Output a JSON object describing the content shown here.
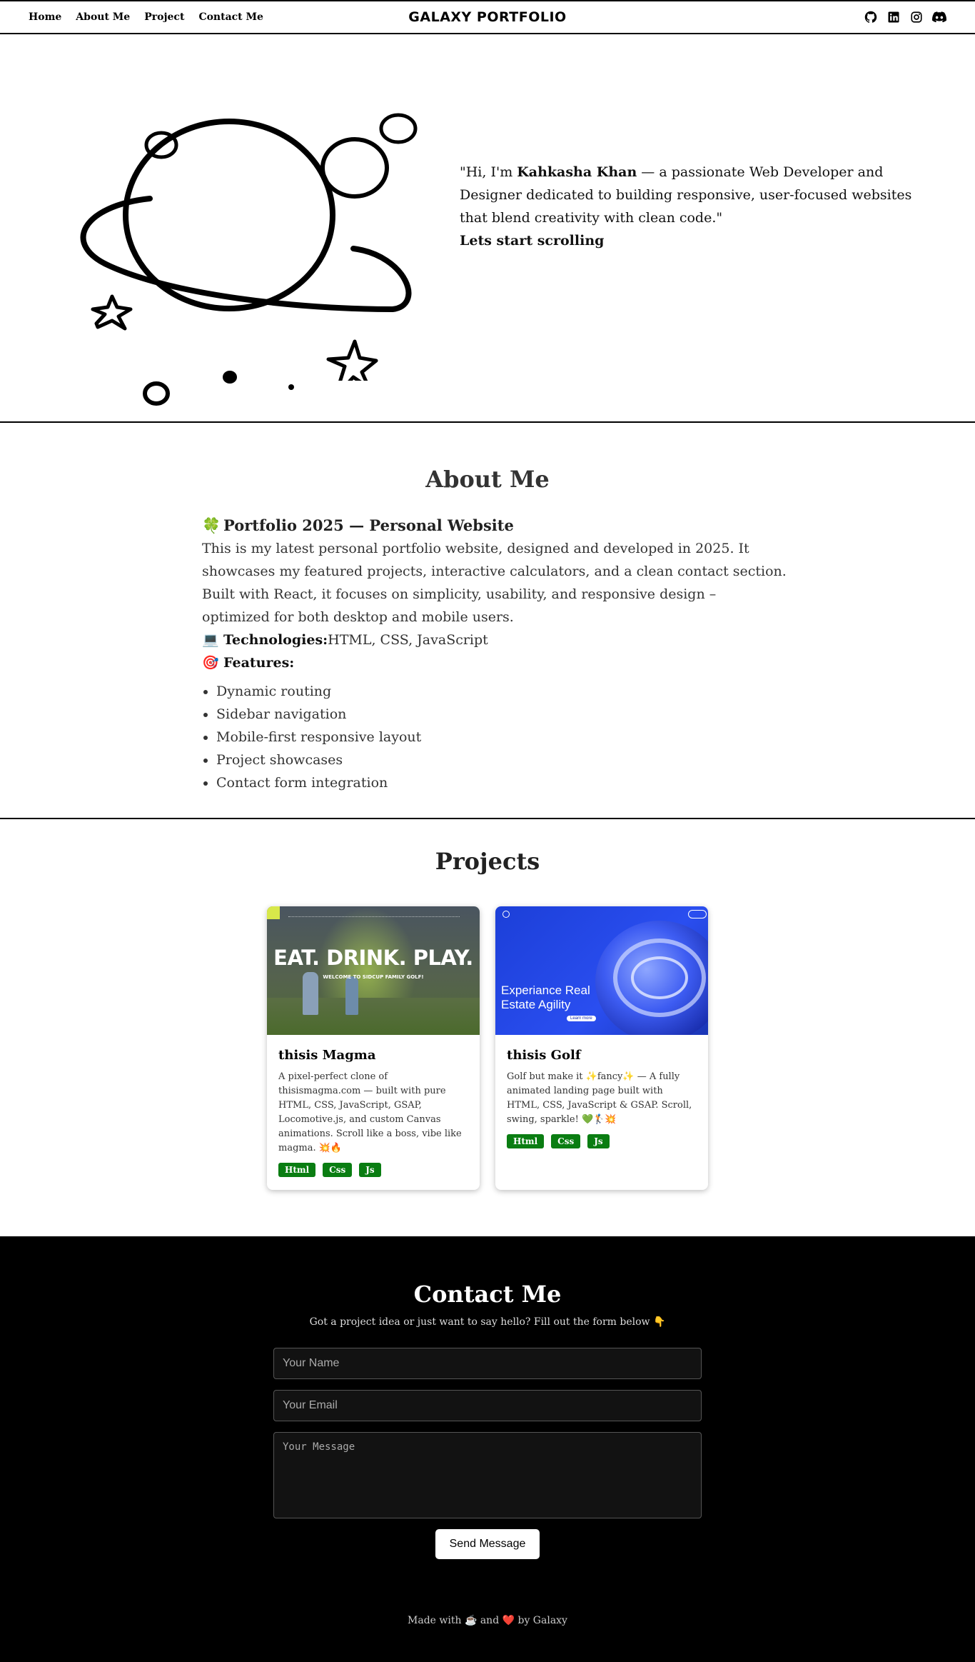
{
  "nav": {
    "links": [
      "Home",
      "About Me",
      "Project",
      "Contact Me"
    ],
    "brand": "GALAXY PORTFOLIO",
    "social": [
      "github-icon",
      "linkedin-icon",
      "instagram-icon",
      "discord-icon"
    ]
  },
  "hero": {
    "intro_pre": "\"Hi, I'm ",
    "name": "Kahkasha Khan",
    "intro_post": " — a passionate Web Developer and Designer dedicated to building responsive, user-focused websites that blend creativity with clean code.\"",
    "cta": "Lets start scrolling"
  },
  "about": {
    "title": "About Me",
    "heading_emoji": "🍀",
    "heading": "Portfolio 2025 — Personal Website",
    "description": "This is my latest personal portfolio website, designed and developed in 2025. It showcases my featured projects, interactive calculators, and a clean contact section. Built with React, it focuses on simplicity, usability, and responsive design – optimized for both desktop and mobile users.",
    "tech_emoji": "💻",
    "tech_label": "Technologies:",
    "tech_value": "HTML, CSS, JavaScript",
    "features_emoji": "🎯",
    "features_label": "Features:",
    "features": [
      "Dynamic routing",
      "Sidebar navigation",
      "Mobile-first responsive layout",
      "Project showcases",
      "Contact form integration"
    ]
  },
  "projects": {
    "title": "Projects",
    "items": [
      {
        "title": "thisis Magma",
        "image_headline": "EAT. DRINK. PLAY.",
        "image_sub": "WELCOME TO SIDCUP FAMILY GOLF!",
        "description": "A pixel-perfect clone of thisismagma.com — built with pure HTML, CSS, JavaScript, GSAP, Locomotive.js, and custom Canvas animations. Scroll like a boss, vibe like magma. 💥🔥",
        "tags": [
          "Html",
          "Css",
          "Js"
        ]
      },
      {
        "title": "thisis Golf",
        "image_headline": "Experiance Real Estate Agility",
        "image_sub": "Learn more",
        "description": "Golf but make it ✨fancy✨ — A fully animated landing page built with HTML, CSS, JavaScript & GSAP. Scroll, swing, sparkle! 💚🏌💥",
        "tags": [
          "Html",
          "Css",
          "Js"
        ]
      }
    ]
  },
  "contact": {
    "title": "Contact Me",
    "subtitle": "Got a project idea or just want to say hello? Fill out the form below 👇",
    "name_placeholder": "Your Name",
    "email_placeholder": "Your Email",
    "message_placeholder": "Your Message",
    "send_label": "Send Message",
    "footer": "Made with ☕ and ❤️ by Galaxy"
  },
  "colors": {
    "tag_bg": "#0a7d12",
    "contact_bg": "#000000"
  }
}
